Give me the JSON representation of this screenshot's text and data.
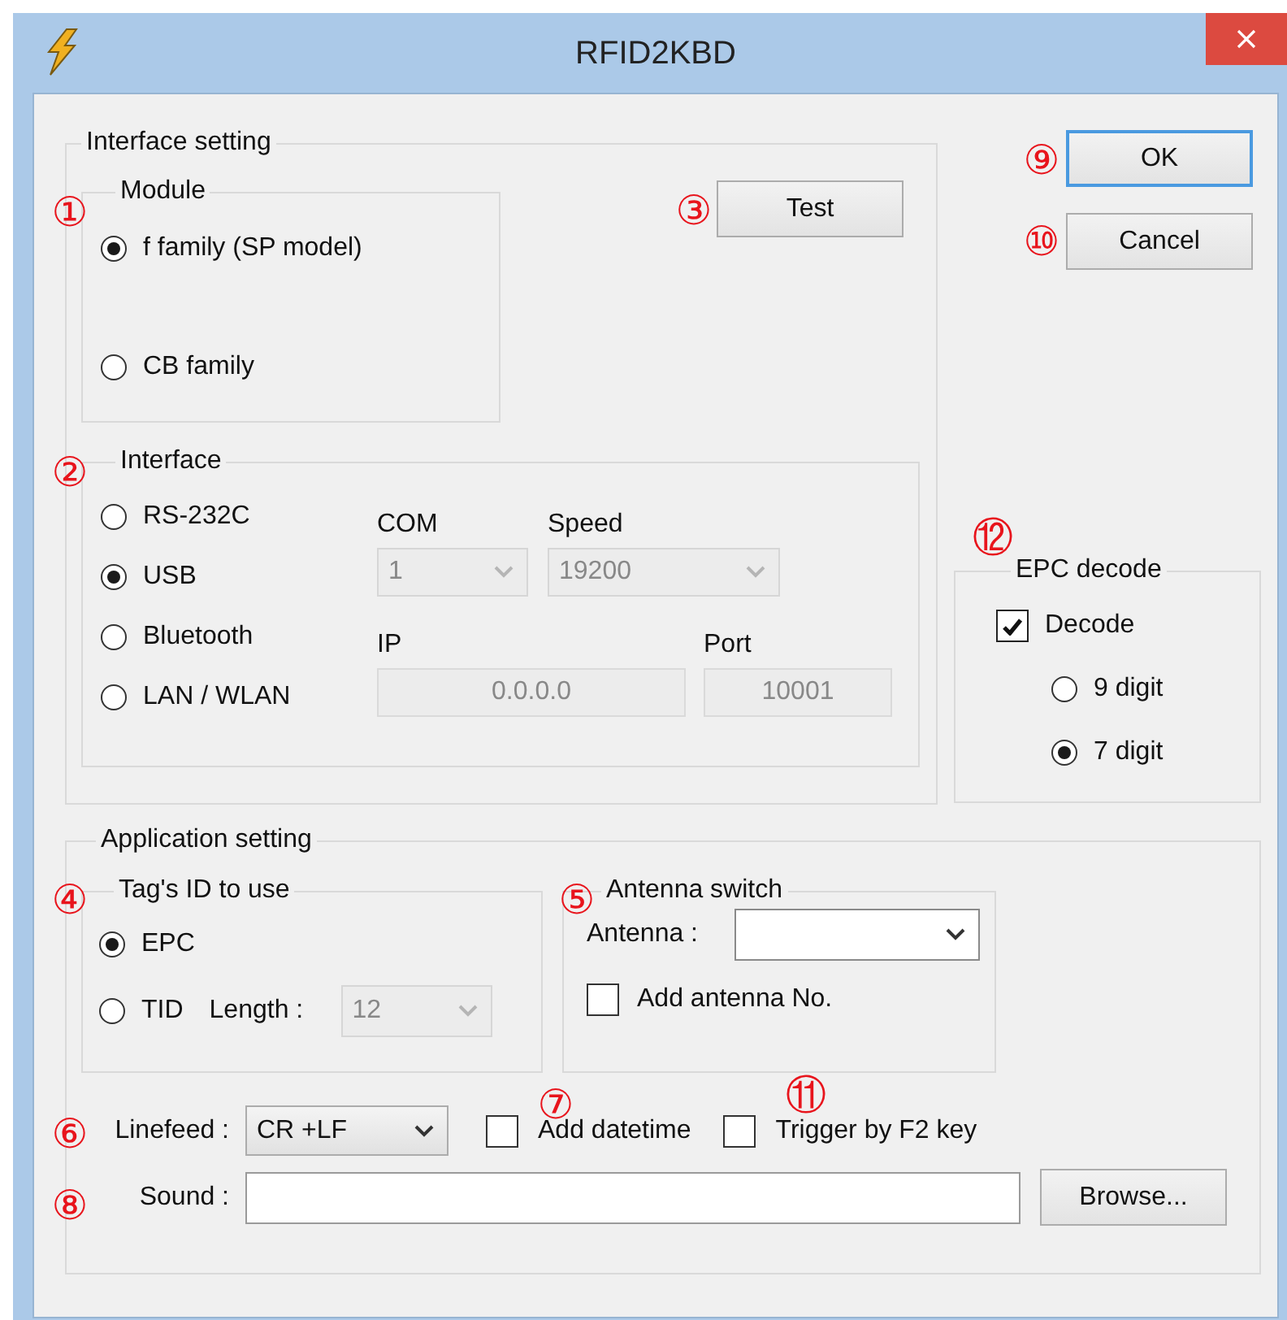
{
  "window": {
    "title": "RFID2KBD"
  },
  "interface_setting": {
    "title": "Interface setting",
    "module": {
      "title": "Module",
      "options": [
        {
          "label": "f family (SP model)",
          "selected": true
        },
        {
          "label": "CB family",
          "selected": false
        }
      ]
    },
    "test_button": "Test",
    "interface": {
      "title": "Interface",
      "options": [
        {
          "label": "RS-232C",
          "selected": false
        },
        {
          "label": "USB",
          "selected": true
        },
        {
          "label": "Bluetooth",
          "selected": false
        },
        {
          "label": "LAN / WLAN",
          "selected": false
        }
      ],
      "com": {
        "label": "COM",
        "value": "1",
        "disabled": true
      },
      "speed": {
        "label": "Speed",
        "value": "19200",
        "disabled": true
      },
      "ip": {
        "label": "IP",
        "value": "0.0.0.0",
        "disabled": true
      },
      "port": {
        "label": "Port",
        "value": "10001",
        "disabled": true
      }
    }
  },
  "buttons": [
    {
      "label": "OK",
      "default": true
    },
    {
      "label": "Cancel",
      "default": false
    }
  ],
  "epc_decode": {
    "title": "EPC decode",
    "decode": {
      "label": "Decode",
      "checked": true
    },
    "options": [
      {
        "label": "9 digit",
        "selected": false
      },
      {
        "label": "7 digit",
        "selected": true
      }
    ]
  },
  "application_setting": {
    "title": "Application setting",
    "tag_id": {
      "title": "Tag's ID to use",
      "options": [
        {
          "label": "EPC",
          "selected": true
        },
        {
          "label": "TID",
          "selected": false
        }
      ],
      "length": {
        "label": "Length :",
        "value": "12",
        "disabled": true
      }
    },
    "antenna_switch": {
      "title": "Antenna switch",
      "antenna": {
        "label": "Antenna :",
        "disabled": false
      },
      "add_antenna_no": {
        "label": "Add antenna No.",
        "checked": false
      }
    },
    "linefeed": {
      "label": "Linefeed :",
      "value": "CR +LF"
    },
    "add_datetime": {
      "label": "Add datetime",
      "checked": false
    },
    "trigger_f2": {
      "label": "Trigger by F2 key",
      "checked": false
    },
    "sound": {
      "label": "Sound :"
    },
    "browse_button": "Browse..."
  },
  "annotations": [
    {
      "label": "①"
    },
    {
      "label": "②"
    },
    {
      "label": "③"
    },
    {
      "label": "④"
    },
    {
      "label": "⑤"
    },
    {
      "label": "⑥"
    },
    {
      "label": "⑦"
    },
    {
      "label": "⑧"
    },
    {
      "label": "⑨"
    },
    {
      "label": "⑩"
    },
    {
      "label": "⑪"
    },
    {
      "label": "⑫"
    }
  ]
}
